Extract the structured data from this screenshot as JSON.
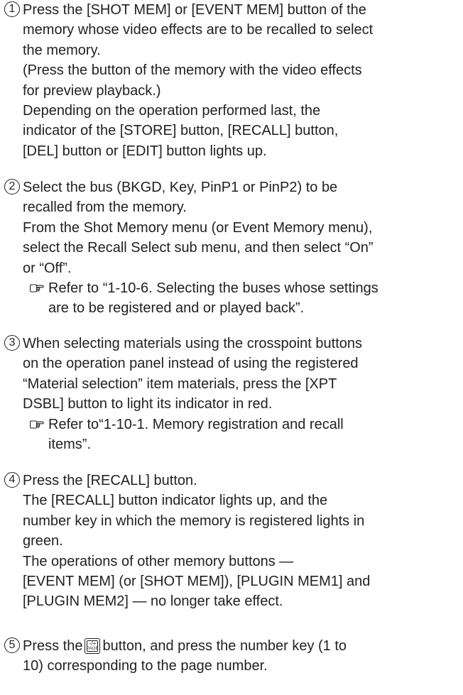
{
  "steps": [
    {
      "number": "1",
      "lines": [
        "Press the [SHOT MEM] or [EVENT MEM] button of the",
        "memory whose video effects are to be recalled to select",
        "the memory.",
        "(Press the button of the memory with the video effects",
        "for preview playback.)",
        "Depending on the operation performed last, the",
        "indicator of the [STORE] button, [RECALL] button,",
        "[DEL] button or [EDIT] button lights up."
      ]
    },
    {
      "number": "2",
      "lines": [
        "Select the bus (BKGD, Key, PinP1 or PinP2) to be",
        "recalled from the memory.",
        "From the Shot Memory menu (or Event Memory menu),",
        "select the Recall Select sub menu, and then select “On”",
        "or “Off”."
      ],
      "reference": [
        "Refer to “1-10-6. Selecting the buses whose settings",
        "are to be registered and or played back”."
      ]
    },
    {
      "number": "3",
      "lines": [
        "When selecting materials using the crosspoint buttons",
        "on the operation panel instead of using the registered",
        "“Material selection” item materials, press the [XPT",
        "DSBL] button to light its indicator in red."
      ],
      "reference": [
        "Refer to“1-10-1. Memory registration and recall",
        "items”."
      ]
    },
    {
      "number": "4",
      "lines": [
        "Press the [RECALL] button.",
        "The [RECALL] button indicator lights up, and the",
        "number key in which the memory is registered lights in",
        "green.",
        "The operations of other memory buttons —",
        "[EVENT MEM] (or [SHOT MEM]), [PLUGIN MEM1] and",
        "[PLUGIN MEM2] — no longer take effect."
      ]
    },
    {
      "number": "5",
      "line_before_key": "Press the",
      "line_after_key": "button, and press the number key (1 to",
      "page_key": {
        "top": "-/+",
        "bottom": "PAGE"
      },
      "lines": [
        "10) corresponding to the page number."
      ]
    }
  ],
  "icons": {
    "reference": "reference-pointing-hand-icon"
  }
}
